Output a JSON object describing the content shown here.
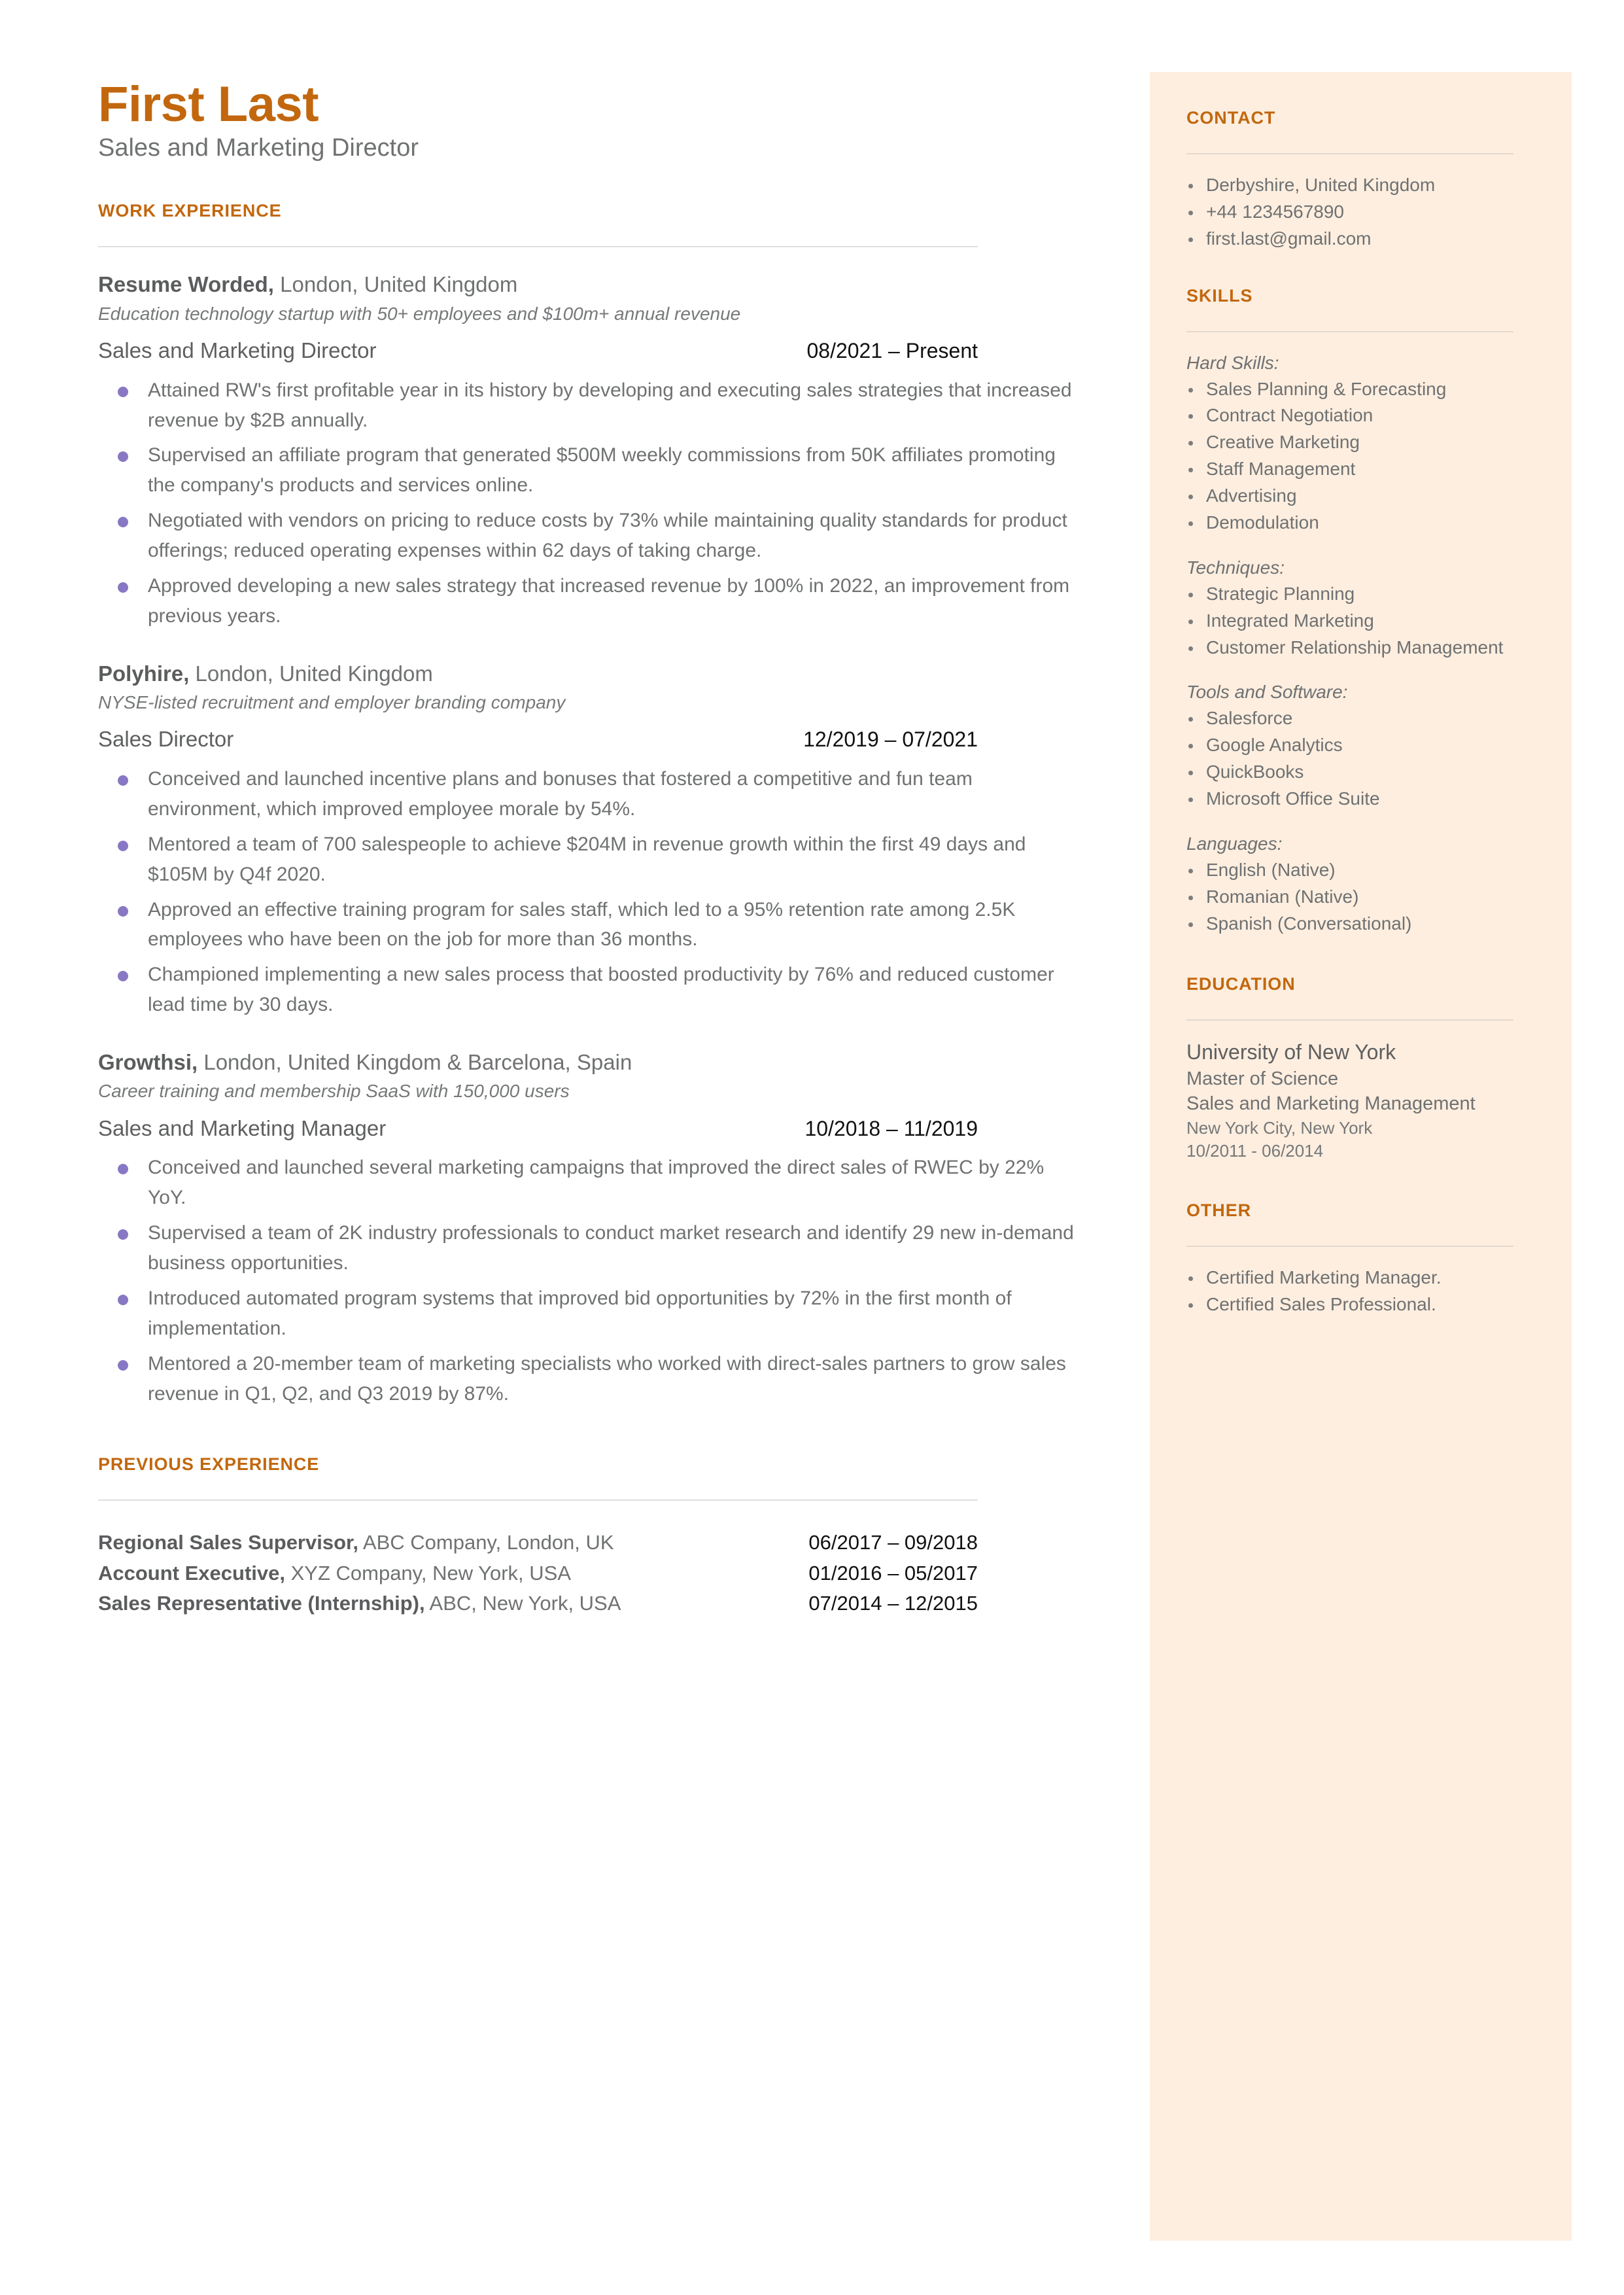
{
  "header": {
    "name": "First Last",
    "headline": "Sales and Marketing Director"
  },
  "colors": {
    "accent": "#C2670E",
    "sidebar_background": "#FDEEDF",
    "body_text": "#6F7172",
    "bullet_dot": "#8878C3",
    "date_text": "#111111",
    "rule": "#DFDFE0"
  },
  "main": {
    "work_experience": {
      "heading": "WORK EXPERIENCE",
      "jobs": [
        {
          "company": "Resume Worded,",
          "location": " London, United Kingdom",
          "description": "Education technology startup with 50+ employees and $100m+ annual revenue",
          "role": "Sales and Marketing Director",
          "dates": "08/2021 – Present",
          "bullets": [
            "Attained RW's first profitable year in its history by developing and executing sales strategies that increased revenue by $2B annually.",
            "Supervised an affiliate program that generated  $500M weekly commissions from 50K affiliates promoting the company's products and services online.",
            "Negotiated with vendors on pricing to reduce costs by 73% while maintaining quality standards for product offerings; reduced operating expenses within 62 days of taking charge.",
            "Approved developing a new sales strategy that increased revenue by 100% in 2022, an improvement from previous years."
          ]
        },
        {
          "company": "Polyhire,",
          "location": " London, United Kingdom",
          "description": "NYSE-listed recruitment and employer branding company",
          "role": "Sales Director",
          "dates": "12/2019 – 07/2021",
          "bullets": [
            "Conceived and launched incentive plans and bonuses that fostered a competitive and fun team environment, which improved employee morale by 54%.",
            "Mentored a team of 700 salespeople to achieve $204M in revenue growth within the first 49 days and $105M by Q4f 2020.",
            "Approved an effective training program for sales staff, which led to a 95% retention rate among 2.5K employees who have been on the job for more than 36 months.",
            "Championed implementing a new sales process that boosted productivity by 76% and reduced customer lead time by 30 days."
          ]
        },
        {
          "company": "Growthsi,",
          "location": " London, United Kingdom & Barcelona, Spain",
          "description": "Career training and membership SaaS with 150,000 users",
          "role": "Sales and Marketing Manager",
          "dates": "10/2018 – 11/2019",
          "bullets": [
            "Conceived and launched several marketing campaigns that improved the direct sales of RWEC by 22% YoY.",
            "Supervised a team of 2K industry professionals to conduct market research and identify 29 new in-demand business opportunities.",
            "Introduced automated program systems that improved bid opportunities by 72% in the first month of implementation.",
            "Mentored a 20-member team of marketing specialists who worked with direct-sales partners to grow sales revenue in Q1, Q2, and Q3 2019 by 87%."
          ]
        }
      ]
    },
    "previous_experience": {
      "heading": "PREVIOUS EXPERIENCE",
      "rows": [
        {
          "title": "Regional Sales Supervisor,",
          "detail": " ABC Company, London, UK",
          "dates": "06/2017 – 09/2018"
        },
        {
          "title": "Account Executive,",
          "detail": " XYZ Company, New York, USA",
          "dates": "01/2016 – 05/2017"
        },
        {
          "title": "Sales Representative (Internship),",
          "detail": " ABC, New York, USA",
          "dates": "07/2014 – 12/2015"
        }
      ]
    }
  },
  "sidebar": {
    "contact": {
      "heading": "CONTACT",
      "items": [
        "Derbyshire, United Kingdom",
        "+44 1234567890",
        "first.last@gmail.com"
      ]
    },
    "skills": {
      "heading": "SKILLS",
      "groups": [
        {
          "label": "Hard Skills:",
          "items": [
            "Sales Planning & Forecasting",
            "Contract Negotiation",
            "Creative Marketing",
            "Staff Management",
            "Advertising",
            "Demodulation"
          ]
        },
        {
          "label": "Techniques:",
          "items": [
            "Strategic Planning",
            "Integrated Marketing",
            "Customer Relationship Management"
          ]
        },
        {
          "label": "Tools and Software:",
          "items": [
            "Salesforce",
            "Google Analytics",
            "QuickBooks",
            "Microsoft Office Suite"
          ]
        },
        {
          "label": "Languages:",
          "items": [
            "English (Native)",
            "Romanian (Native)",
            "Spanish (Conversational)"
          ]
        }
      ]
    },
    "education": {
      "heading": "EDUCATION",
      "school": "University of New York",
      "degree": "Master of Science",
      "field": "Sales and Marketing Management",
      "location": "New York City, New York",
      "dates": "10/2011 - 06/2014"
    },
    "other": {
      "heading": "OTHER",
      "items": [
        "Certified Marketing Manager.",
        "Certified Sales Professional."
      ]
    }
  }
}
